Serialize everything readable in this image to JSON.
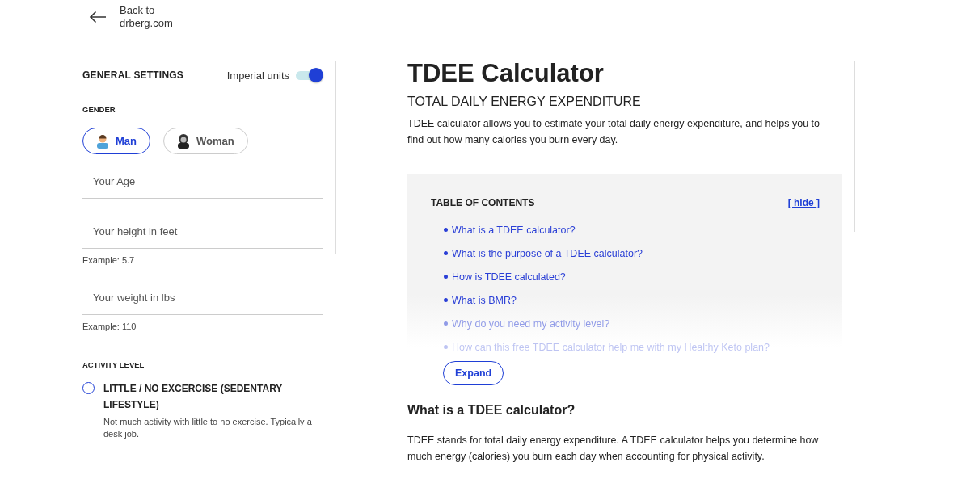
{
  "back_link": {
    "line1": "Back to",
    "line2": "drberg.com"
  },
  "settings": {
    "title": "GENERAL SETTINGS",
    "units_label": "Imperial units",
    "imperial_on": true
  },
  "gender": {
    "label": "GENDER",
    "options": [
      {
        "label": "Man",
        "kind": "man",
        "selected": true
      },
      {
        "label": "Woman",
        "kind": "woman",
        "selected": false
      }
    ]
  },
  "fields": [
    {
      "placeholder": "Your Age"
    },
    {
      "placeholder": "Your height in feet",
      "hint": "Example: 5.7"
    },
    {
      "placeholder": "Your weight in lbs",
      "hint": "Example: 110"
    }
  ],
  "activity": {
    "label": "ACTIVITY LEVEL",
    "options": [
      {
        "title": "LITTLE / NO EXCERCISE (SEDENTARY LIFESTYLE)",
        "description": "Not much activity with little to no exercise. Typically a desk job.",
        "selected": false
      }
    ]
  },
  "article": {
    "title": "TDEE Calculator",
    "subtitle": "TOTAL DAILY ENERGY EXPENDITURE",
    "intro": "TDEE calculator allows you to estimate your total daily energy expenditure, and helps you to find out how many calories you burn every day."
  },
  "toc": {
    "title": "TABLE OF CONTENTS",
    "hide": "[ hide ]",
    "items": [
      "What is a TDEE calculator?",
      "What is the purpose of a TDEE calculator?",
      "How is TDEE calculated?",
      "What is BMR?",
      "Why do you need my activity level?",
      "How can this free TDEE calculator help me with my Healthy Keto plan?"
    ],
    "expand": "Expand"
  },
  "section": {
    "heading": "What is a TDEE calculator?",
    "text": "TDEE stands for total daily energy expenditure. A TDEE calculator helps you determine how much energy (calories) you burn each day when accounting for physical activity."
  }
}
